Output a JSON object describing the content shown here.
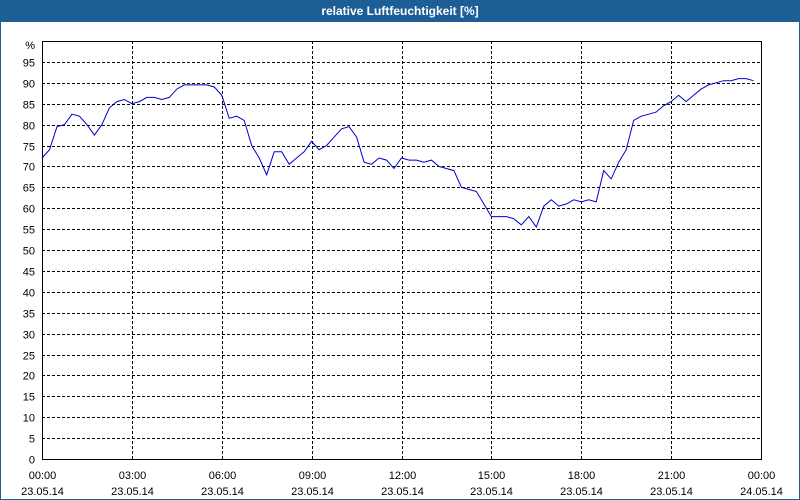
{
  "window": {
    "title": "relative Luftfeuchtigkeit [%]"
  },
  "chart_data": {
    "type": "line",
    "title": "relative Luftfeuchtigkeit [%]",
    "ylabel": "%",
    "xlabel": "",
    "ylim": [
      0,
      100
    ],
    "yticks": [
      0,
      5,
      10,
      15,
      20,
      25,
      30,
      35,
      40,
      45,
      50,
      55,
      60,
      65,
      70,
      75,
      80,
      85,
      90,
      95
    ],
    "xlim": [
      "23.05.14 00:00",
      "24.05.14 00:00"
    ],
    "xticks": [
      {
        "time": "00:00",
        "date": "23.05.14"
      },
      {
        "time": "03:00",
        "date": "23.05.14"
      },
      {
        "time": "06:00",
        "date": "23.05.14"
      },
      {
        "time": "09:00",
        "date": "23.05.14"
      },
      {
        "time": "12:00",
        "date": "23.05.14"
      },
      {
        "time": "15:00",
        "date": "23.05.14"
      },
      {
        "time": "18:00",
        "date": "23.05.14"
      },
      {
        "time": "21:00",
        "date": "23.05.14"
      },
      {
        "time": "00:00",
        "date": "24.05.14"
      }
    ],
    "grid": true,
    "line_color": "#0000cc",
    "series": [
      {
        "x": [
          "00:00",
          "00:15",
          "00:30",
          "00:45",
          "01:00",
          "01:15",
          "01:30",
          "01:45",
          "02:00",
          "02:15",
          "02:30",
          "02:45",
          "03:00",
          "03:15",
          "03:30",
          "03:45",
          "04:00",
          "04:15",
          "04:30",
          "04:45",
          "05:00",
          "05:15",
          "05:30",
          "05:45",
          "06:00",
          "06:15",
          "06:30",
          "06:45",
          "07:00",
          "07:15",
          "07:30",
          "07:45",
          "08:00",
          "08:15",
          "08:30",
          "08:45",
          "09:00",
          "09:15",
          "09:30",
          "09:45",
          "10:00",
          "10:15",
          "10:30",
          "10:45",
          "11:00",
          "11:15",
          "11:30",
          "11:45",
          "12:00",
          "12:15",
          "12:30",
          "12:45",
          "13:00",
          "13:15",
          "13:30",
          "13:45",
          "14:00",
          "14:15",
          "14:30",
          "14:45",
          "15:00",
          "15:15",
          "15:30",
          "15:45",
          "16:00",
          "16:15",
          "16:30",
          "16:45",
          "17:00",
          "17:15",
          "17:30",
          "17:45",
          "18:00",
          "18:15",
          "18:30",
          "18:45",
          "19:00",
          "19:15",
          "19:30",
          "19:45",
          "20:00",
          "20:15",
          "20:30",
          "20:45",
          "21:00",
          "21:15",
          "21:30",
          "21:45",
          "22:00",
          "22:15",
          "22:30",
          "22:45",
          "23:00",
          "23:15",
          "23:30",
          "23:45"
        ],
        "y": [
          72,
          74,
          79.5,
          80,
          82.5,
          82,
          80,
          77.5,
          80,
          84,
          85.5,
          86,
          85,
          85.5,
          86.5,
          86.5,
          86,
          86.5,
          88.5,
          89.5,
          89.5,
          89.5,
          89.5,
          89,
          87,
          81.5,
          82,
          81,
          75,
          72,
          68,
          73.5,
          73.5,
          70.5,
          72,
          73.5,
          76,
          74,
          75,
          77,
          79,
          79.5,
          77,
          71,
          70.5,
          72,
          71.5,
          69.5,
          72,
          71.5,
          71.5,
          71,
          71.5,
          70,
          69.5,
          69,
          65,
          64.5,
          64,
          61,
          58,
          58,
          58,
          57.5,
          56,
          58,
          55.5,
          60.5,
          62,
          60.5,
          61,
          62,
          61.5,
          62,
          61.5,
          69,
          67,
          71,
          74,
          81,
          82,
          82.5,
          83,
          84.5,
          85.5,
          87,
          85.5,
          87,
          88.5,
          89.5,
          90,
          90.5,
          90.5,
          91,
          91,
          90.5
        ]
      }
    ]
  }
}
